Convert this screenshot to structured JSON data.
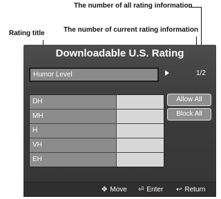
{
  "annotations": {
    "all_count": "The number of all rating information",
    "rating_title": "Rating title",
    "current_count": "The number of current rating information"
  },
  "dialog": {
    "title": "Downloadable U.S. Rating",
    "selected_field": "Humor Level",
    "pager": "1/2",
    "rows": [
      {
        "label": "DH"
      },
      {
        "label": "MH"
      },
      {
        "label": "H"
      },
      {
        "label": "VH"
      },
      {
        "label": "EH"
      }
    ],
    "buttons": {
      "allow_all": "Allow All",
      "block_all": "Block All"
    },
    "footer": {
      "move": "Move",
      "enter": "Enter",
      "return": "Return"
    }
  },
  "colors": {
    "dialog_bg": "#3c3c3c",
    "field_bg": "#8a8a8a",
    "cell_left": "#8c8c8c",
    "cell_right": "#d7d7d7"
  },
  "icons": [
    "move-icon",
    "enter-icon",
    "return-icon",
    "right-arrow-icon"
  ]
}
